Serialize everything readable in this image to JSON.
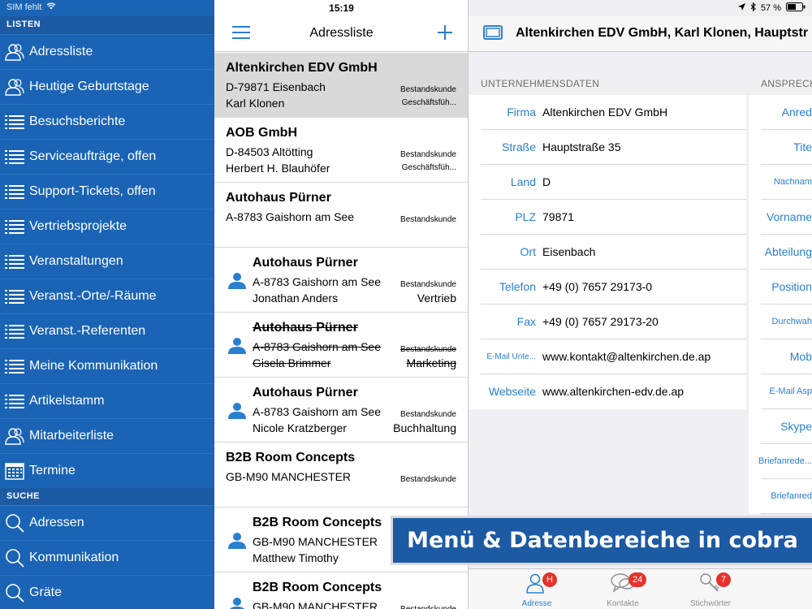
{
  "status": {
    "carrier": "SIM fehlt",
    "time": "15:19",
    "battery": "57 %"
  },
  "sidebar": {
    "lists_header": "LISTEN",
    "search_header": "SUCHE",
    "items": [
      {
        "label": "Adressliste",
        "icon": "people-icon"
      },
      {
        "label": "Heutige Geburtstage",
        "icon": "people-icon"
      },
      {
        "label": "Besuchsberichte",
        "icon": "list-icon"
      },
      {
        "label": "Serviceaufträge, offen",
        "icon": "list-icon"
      },
      {
        "label": "Support-Tickets, offen",
        "icon": "list-icon"
      },
      {
        "label": "Vertriebsprojekte",
        "icon": "list-icon"
      },
      {
        "label": "Veranstaltungen",
        "icon": "list-icon"
      },
      {
        "label": "Veranst.-Orte/-Räume",
        "icon": "list-icon"
      },
      {
        "label": "Veranst.-Referenten",
        "icon": "list-icon"
      },
      {
        "label": "Meine Kommunikation",
        "icon": "list-icon"
      },
      {
        "label": "Artikelstamm",
        "icon": "list-icon"
      },
      {
        "label": "Mitarbeiterliste",
        "icon": "people-icon"
      },
      {
        "label": "Termine",
        "icon": "calendar-icon"
      }
    ],
    "search_items": [
      {
        "label": "Adressen",
        "icon": "search-icon"
      },
      {
        "label": "Kommunikation",
        "icon": "search-icon"
      },
      {
        "label": "Gräte",
        "icon": "search-icon"
      }
    ]
  },
  "list": {
    "title": "Adressliste",
    "rows": [
      {
        "name": "Altenkirchen EDV GmbH",
        "line2": "D-79871 Eisenbach",
        "line3": "Karl Klonen",
        "tag1": "Bestandskunde",
        "tag2": "Geschäftsfüh...",
        "person": false,
        "selected": true,
        "struck": false
      },
      {
        "name": "AOB GmbH",
        "line2": "D-84503 Altötting",
        "line3": "Herbert H. Blauhöfer",
        "tag1": "Bestandskunde",
        "tag2": "Geschäftsfüh...",
        "person": false,
        "selected": false,
        "struck": false
      },
      {
        "name": "Autohaus Pürner",
        "line2": "A-8783 Gaishorn am See",
        "line3": "",
        "tag1": "Bestandskunde",
        "tag2": "",
        "person": false,
        "selected": false,
        "struck": false
      },
      {
        "name": "Autohaus Pürner",
        "line2": "A-8783 Gaishorn am See",
        "line3": "Jonathan Anders",
        "tag1": "Bestandskunde",
        "tag2": "Vertrieb",
        "person": true,
        "selected": false,
        "struck": false
      },
      {
        "name": "Autohaus Pürner",
        "line2": "A-8783 Gaishorn am See",
        "line3": "Gisela Brimmer",
        "tag1": "Bestandskunde",
        "tag2": "Marketing",
        "person": true,
        "selected": false,
        "struck": true
      },
      {
        "name": "Autohaus Pürner",
        "line2": "A-8783 Gaishorn am See",
        "line3": "Nicole Kratzberger",
        "tag1": "Bestandskunde",
        "tag2": "Buchhaltung",
        "person": true,
        "selected": false,
        "struck": false
      },
      {
        "name": "B2B Room Concepts",
        "line2": "GB-M90 MANCHESTER",
        "line3": "",
        "tag1": "Bestandskunde",
        "tag2": "",
        "person": false,
        "selected": false,
        "struck": false
      },
      {
        "name": "B2B Room Concepts",
        "line2": "GB-M90 MANCHESTER",
        "line3": "Matthew  Timothy",
        "tag1": "",
        "tag2": "",
        "person": true,
        "selected": false,
        "struck": false
      },
      {
        "name": "B2B Room Concepts",
        "line2": "GB-M90 MANCHESTER",
        "line3": "",
        "tag1": "Bestandskunde",
        "tag2": "",
        "person": true,
        "selected": false,
        "struck": false
      }
    ]
  },
  "detail": {
    "title": "Altenkirchen EDV GmbH, Karl Klonen, Hauptstr",
    "company_section": "UNTERNEHMENSDATEN",
    "contact_section": "ANSPRECH",
    "company_fields": [
      {
        "label": "Firma",
        "value": "Altenkirchen EDV GmbH",
        "small": false
      },
      {
        "label": "Straße",
        "value": "Hauptstraße 35",
        "small": false
      },
      {
        "label": "Land",
        "value": "D",
        "small": false
      },
      {
        "label": "PLZ",
        "value": "79871",
        "small": false
      },
      {
        "label": "Ort",
        "value": "Eisenbach",
        "small": false
      },
      {
        "label": "Telefon",
        "value": "+49 (0) 7657 29173-0",
        "small": false
      },
      {
        "label": "Fax",
        "value": "+49 (0) 7657 29173-20",
        "small": false
      },
      {
        "label": "E-Mail Unte...",
        "value": "www.kontakt@altenkirchen.de.ap",
        "small": true
      },
      {
        "label": "Webseite",
        "value": "www.altenkirchen-edv.de.ap",
        "small": false
      }
    ],
    "contact_fields": [
      {
        "label": "Anred",
        "small": false
      },
      {
        "label": "Tite",
        "small": false
      },
      {
        "label": "Nachnam",
        "small": true
      },
      {
        "label": "Vorname",
        "small": false
      },
      {
        "label": "Abteilung",
        "small": false
      },
      {
        "label": "Position",
        "small": false
      },
      {
        "label": "Durchwah",
        "small": true
      },
      {
        "label": "Mob",
        "small": false
      },
      {
        "label": "E-Mail Asp",
        "small": true
      },
      {
        "label": "Skype",
        "small": false
      },
      {
        "label": "Briefanrede...",
        "small": true
      },
      {
        "label": "Briefanred",
        "small": true
      }
    ]
  },
  "tabbar": {
    "tabs": [
      {
        "label": "Adresse",
        "badge": "H",
        "icon": "address-icon"
      },
      {
        "label": "Kontakte",
        "badge": "24",
        "icon": "contacts-icon"
      },
      {
        "label": "Stichwörter",
        "badge": "7",
        "icon": "keys-icon"
      }
    ]
  },
  "banner": {
    "text": "Menü & Datenbereiche in cobra"
  },
  "colors": {
    "sidebar": "#1a63b5",
    "accent": "#2a7fd0",
    "badge": "#e5332a",
    "banner": "#1c5aa3"
  }
}
